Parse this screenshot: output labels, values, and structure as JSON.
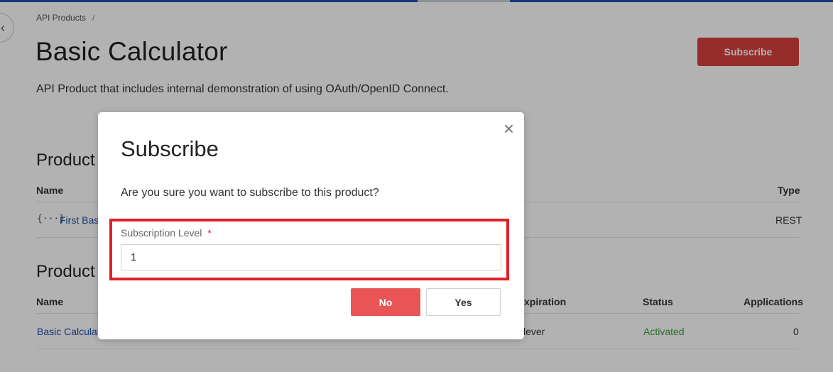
{
  "breadcrumb": {
    "item": "API Products",
    "separator": "/"
  },
  "page": {
    "title": "Basic Calculator",
    "subscribe_label": "Subscribe",
    "description": "API Product that includes internal demonstration of using OAuth/OpenID Connect."
  },
  "section1": {
    "title_visible": "Product",
    "col_name": "Name",
    "col_type": "Type",
    "row": {
      "icon": "{···}",
      "name": "First Bas",
      "type": "REST"
    }
  },
  "section2": {
    "title_visible": "Product",
    "col_name": "Name",
    "col_expiration": "xpiration",
    "col_status": "Status",
    "col_applications": "Applications",
    "row": {
      "name": "Basic Calculat",
      "expiration": "lever",
      "status": "Activated",
      "applications": "0"
    }
  },
  "modal": {
    "title": "Subscribe",
    "close_icon": "×",
    "question": "Are you sure you want to subscribe to this product?",
    "field_label": "Subscription Level",
    "required_mark": "*",
    "field_value": "1",
    "no_label": "No",
    "yes_label": "Yes"
  },
  "colors": {
    "accent_red": "#d9413d",
    "no_button": "#e95555",
    "highlight_border": "#e0202a",
    "link": "#1f4fa5",
    "status_green": "#3c9b3c"
  }
}
